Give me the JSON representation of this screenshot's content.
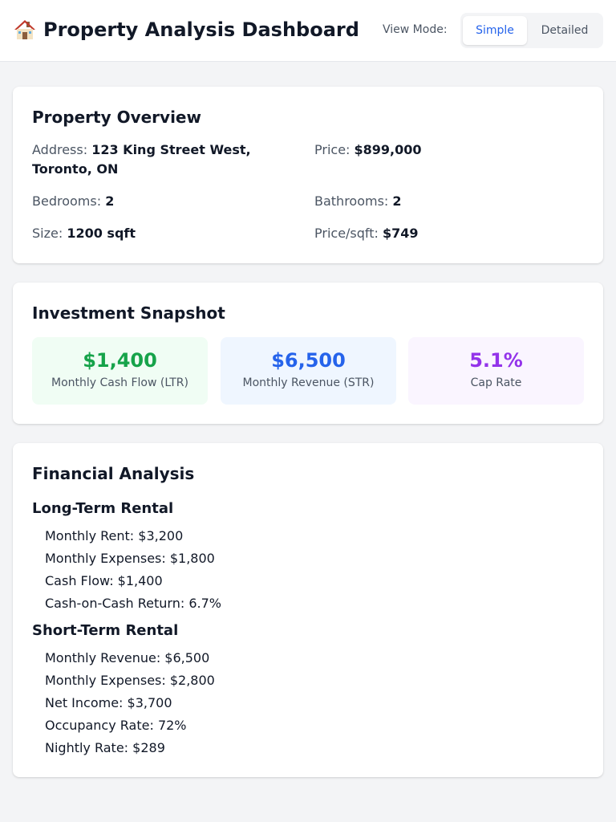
{
  "header": {
    "title": "Property Analysis Dashboard",
    "icon": "house-icon",
    "view_mode_label": "View Mode:",
    "view_modes": [
      "Simple",
      "Detailed"
    ],
    "selected_view_mode": "Simple"
  },
  "overview": {
    "title": "Property Overview",
    "address_label": "Address:",
    "address_value": "123 King Street West, Toronto, ON",
    "price_label": "Price:",
    "price_value": "$899,000",
    "bedrooms_label": "Bedrooms:",
    "bedrooms_value": "2",
    "bathrooms_label": "Bathrooms:",
    "bathrooms_value": "2",
    "size_label": "Size:",
    "size_value": "1200 sqft",
    "price_sqft_label": "Price/sqft:",
    "price_sqft_value": "$749"
  },
  "snapshot": {
    "title": "Investment Snapshot",
    "cards": [
      {
        "value": "$1,400",
        "label": "Monthly Cash Flow (LTR)",
        "color": "#16a34a",
        "bg": "#f0fdf4"
      },
      {
        "value": "$6,500",
        "label": "Monthly Revenue (STR)",
        "color": "#2563eb",
        "bg": "#eff6ff"
      },
      {
        "value": "5.1%",
        "label": "Cap Rate",
        "color": "#9333ea",
        "bg": "#faf5ff"
      }
    ]
  },
  "financial": {
    "title": "Financial Analysis",
    "ltr": {
      "title": "Long-Term Rental",
      "lines": [
        "Monthly Rent: $3,200",
        "Monthly Expenses: $1,800",
        "Cash Flow: $1,400",
        "Cash-on-Cash Return: 6.7%"
      ]
    },
    "str": {
      "title": "Short-Term Rental",
      "lines": [
        "Monthly Revenue: $6,500",
        "Monthly Expenses: $2,800",
        "Net Income: $3,700",
        "Occupancy Rate: 72%",
        "Nightly Rate: $289"
      ]
    }
  }
}
